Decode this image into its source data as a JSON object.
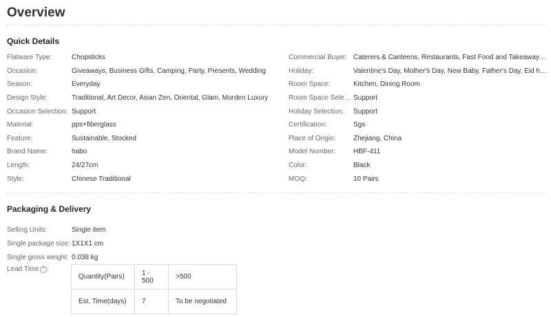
{
  "overview_title": "Overview",
  "quick_details": {
    "title": "Quick Details",
    "left": [
      {
        "label": "Flatware Type:",
        "value": "Chopsticks"
      },
      {
        "label": "Occasion:",
        "value": "Giveaways, Business Gifts, Camping, Party, Presents, Wedding"
      },
      {
        "label": "Season:",
        "value": "Everyday"
      },
      {
        "label": "Design Style:",
        "value": "Traditional, Art Decor, Asian Zen, Oriental, Glam, Morden Luxury"
      },
      {
        "label": "Occasion Selection:",
        "value": "Support"
      },
      {
        "label": "Material:",
        "value": "pps+fiberglass"
      },
      {
        "label": "Feature:",
        "value": "Sustainable, Stocked"
      },
      {
        "label": "Brand Name:",
        "value": "habo"
      },
      {
        "label": "Length:",
        "value": "24/27cm"
      },
      {
        "label": "Style:",
        "value": "Chinese Traditional"
      }
    ],
    "right": [
      {
        "label": "Commercial Buyer:",
        "value": "Caterers & Canteens, Restaurants, Fast Food and Takeaway F..."
      },
      {
        "label": "Holiday:",
        "value": "Valentine's Day, Mother's Day, New Baby, Father's Day, Eid holi..."
      },
      {
        "label": "Room Space:",
        "value": "Kitchen, Dining Room"
      },
      {
        "label": "Room Space Select...",
        "value": "Support"
      },
      {
        "label": "Holiday Selection:",
        "value": "Support"
      },
      {
        "label": "Certification:",
        "value": "Sgs"
      },
      {
        "label": "Place of Origin:",
        "value": "Zhejiang, China"
      },
      {
        "label": "Model Number:",
        "value": "HBF-411"
      },
      {
        "label": "Color:",
        "value": "Black"
      },
      {
        "label": "MOQ:",
        "value": "10 Pairs"
      }
    ]
  },
  "packaging": {
    "title": "Packaging & Delivery",
    "rows": [
      {
        "label": "Selling Units:",
        "value": "Single item"
      },
      {
        "label": "Single package size:",
        "value": "1X1X1 cm"
      },
      {
        "label": "Single gross weight:",
        "value": "0.038 kg"
      }
    ],
    "lead_time_label": "Lead Time",
    "lead_time_suffix": ":",
    "help_glyph": "?",
    "lead_table": [
      [
        "Quantity(Pairs)",
        "1 - 500",
        ">500"
      ],
      [
        "Est. Time(days)",
        "7",
        "To be negotiated"
      ]
    ]
  }
}
